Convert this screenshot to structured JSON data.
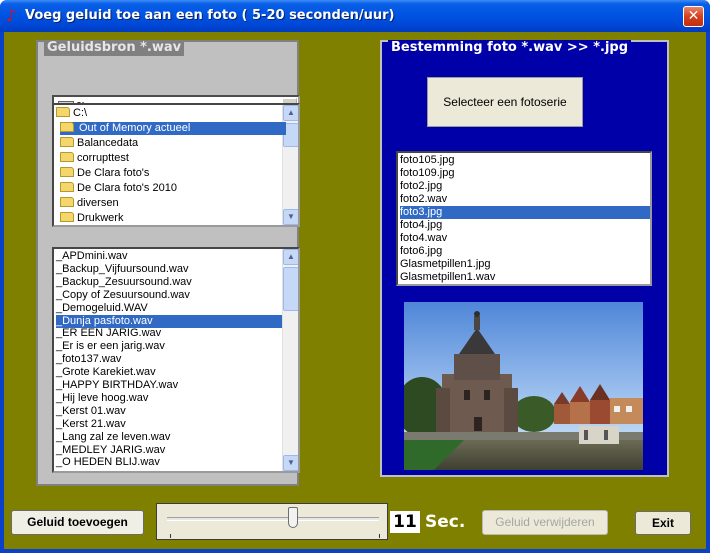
{
  "window": {
    "title": "Voeg geluid toe aan een foto ( 5-20 seconden/uur)",
    "close_symbol": "✕"
  },
  "source": {
    "legend": "Geluidsbron  *.wav",
    "drive": "c:",
    "directories": [
      {
        "label": "C:\\",
        "type": "open-folder"
      },
      {
        "label": "Out of Memory actueel",
        "type": "open-folder",
        "selected": true
      },
      {
        "label": "Balancedata",
        "type": "folder"
      },
      {
        "label": "corrupttest",
        "type": "folder"
      },
      {
        "label": "De Clara foto's",
        "type": "folder"
      },
      {
        "label": "De Clara foto's 2010",
        "type": "folder"
      },
      {
        "label": "diversen",
        "type": "folder"
      },
      {
        "label": "Drukwerk",
        "type": "folder"
      }
    ],
    "files": [
      "_APDmini.wav",
      "_Backup_Vijfuursound.wav",
      "_Backup_Zesuursound.wav",
      "_Copy of Zesuursound.wav",
      "_Demogeluid.WAV",
      "_Dunja pasfoto.wav",
      "_ER EEN JARIG.wav",
      "_Er is er een jarig.wav",
      "_foto137.wav",
      "_Grote Karekiet.wav",
      "_HAPPY BIRTHDAY.wav",
      "_Hij leve hoog.wav",
      "_Kerst 01.wav",
      "_Kerst 21.wav",
      "_Lang zal ze leven.wav",
      "_MEDLEY JARIG.wav",
      "_O HEDEN BLIJ.wav"
    ],
    "selected_file_index": 5
  },
  "destination": {
    "legend": "Bestemming foto  *.wav  >>  *.jpg",
    "select_button": "Selecteer een  fotoserie",
    "files": [
      "foto105.jpg",
      "foto109.jpg",
      "foto2.jpg",
      "foto2.wav",
      "foto3.jpg",
      "foto4.jpg",
      "foto4.wav",
      "foto6.jpg",
      "Glasmetpillen1.jpg",
      "Glasmetpillen1.wav"
    ],
    "selected_file_index": 4
  },
  "controls": {
    "add_button": "Geluid toevoegen",
    "seconds_value": "11",
    "seconds_unit": "Sec.",
    "slider_value_seconds": 11,
    "remove_button": "Geluid verwijderen",
    "exit_button": "Exit"
  },
  "colors": {
    "client_background": "#808000",
    "source_panel": "#c0c0c0",
    "destination_panel": "#0000a8",
    "selection": "#316ac5"
  }
}
